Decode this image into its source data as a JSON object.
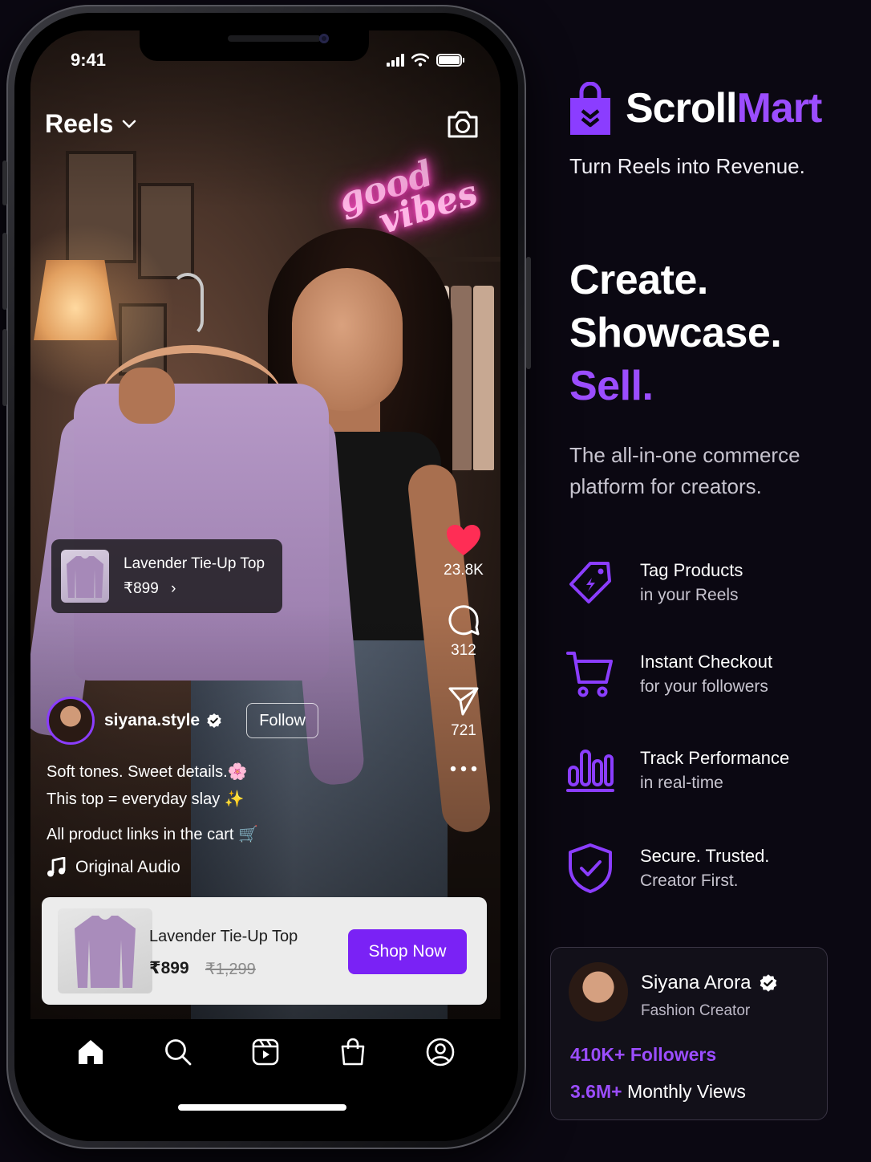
{
  "phone": {
    "status_time": "9:41",
    "header_title": "Reels",
    "neon_text_line1": "good",
    "neon_text_line2": "vibes",
    "product_tag": {
      "name": "Lavender Tie-Up Top",
      "price": "₹899"
    },
    "actions": {
      "likes": "23.8K",
      "comments": "312",
      "shares": "721"
    },
    "creator": {
      "username": "siyana.style",
      "follow_label": "Follow"
    },
    "caption": {
      "line1": "Soft tones. Sweet details.🌸",
      "line2": "This top = everyday slay ✨",
      "line3": "All product links in the cart 🛒"
    },
    "audio_label": "Original Audio",
    "product_bar": {
      "name": "Lavender Tie-Up Top",
      "price": "₹899",
      "old_price": "₹1,299",
      "cta": "Shop Now"
    },
    "tabs": [
      "home",
      "search",
      "reels",
      "shop",
      "profile"
    ]
  },
  "brand": {
    "name_part1": "Scroll",
    "name_part2": "Mart",
    "tagline": "Turn Reels into Revenue."
  },
  "headline": {
    "line1": "Create.",
    "line2": "Showcase.",
    "line3": "Sell."
  },
  "subhead": "The all-in-one commerce platform for creators.",
  "features": [
    {
      "icon": "tag-icon",
      "title": "Tag Products",
      "subtitle": "in your Reels"
    },
    {
      "icon": "cart-icon",
      "title": "Instant Checkout",
      "subtitle": "for your followers"
    },
    {
      "icon": "bar-chart-icon",
      "title": "Track Performance",
      "subtitle": "in real-time"
    },
    {
      "icon": "shield-check-icon",
      "title": "Secure. Trusted.",
      "subtitle": "Creator First."
    }
  ],
  "profile_card": {
    "name": "Siyana Arora",
    "role": "Fashion Creator",
    "followers_value": "410K+",
    "followers_label": "Followers",
    "views_value": "3.6M+",
    "views_label": "Monthly Views"
  },
  "colors": {
    "accent": "#9b4dff",
    "cta": "#7a22f5",
    "like": "#ff2d55",
    "background": "#0b0812"
  }
}
